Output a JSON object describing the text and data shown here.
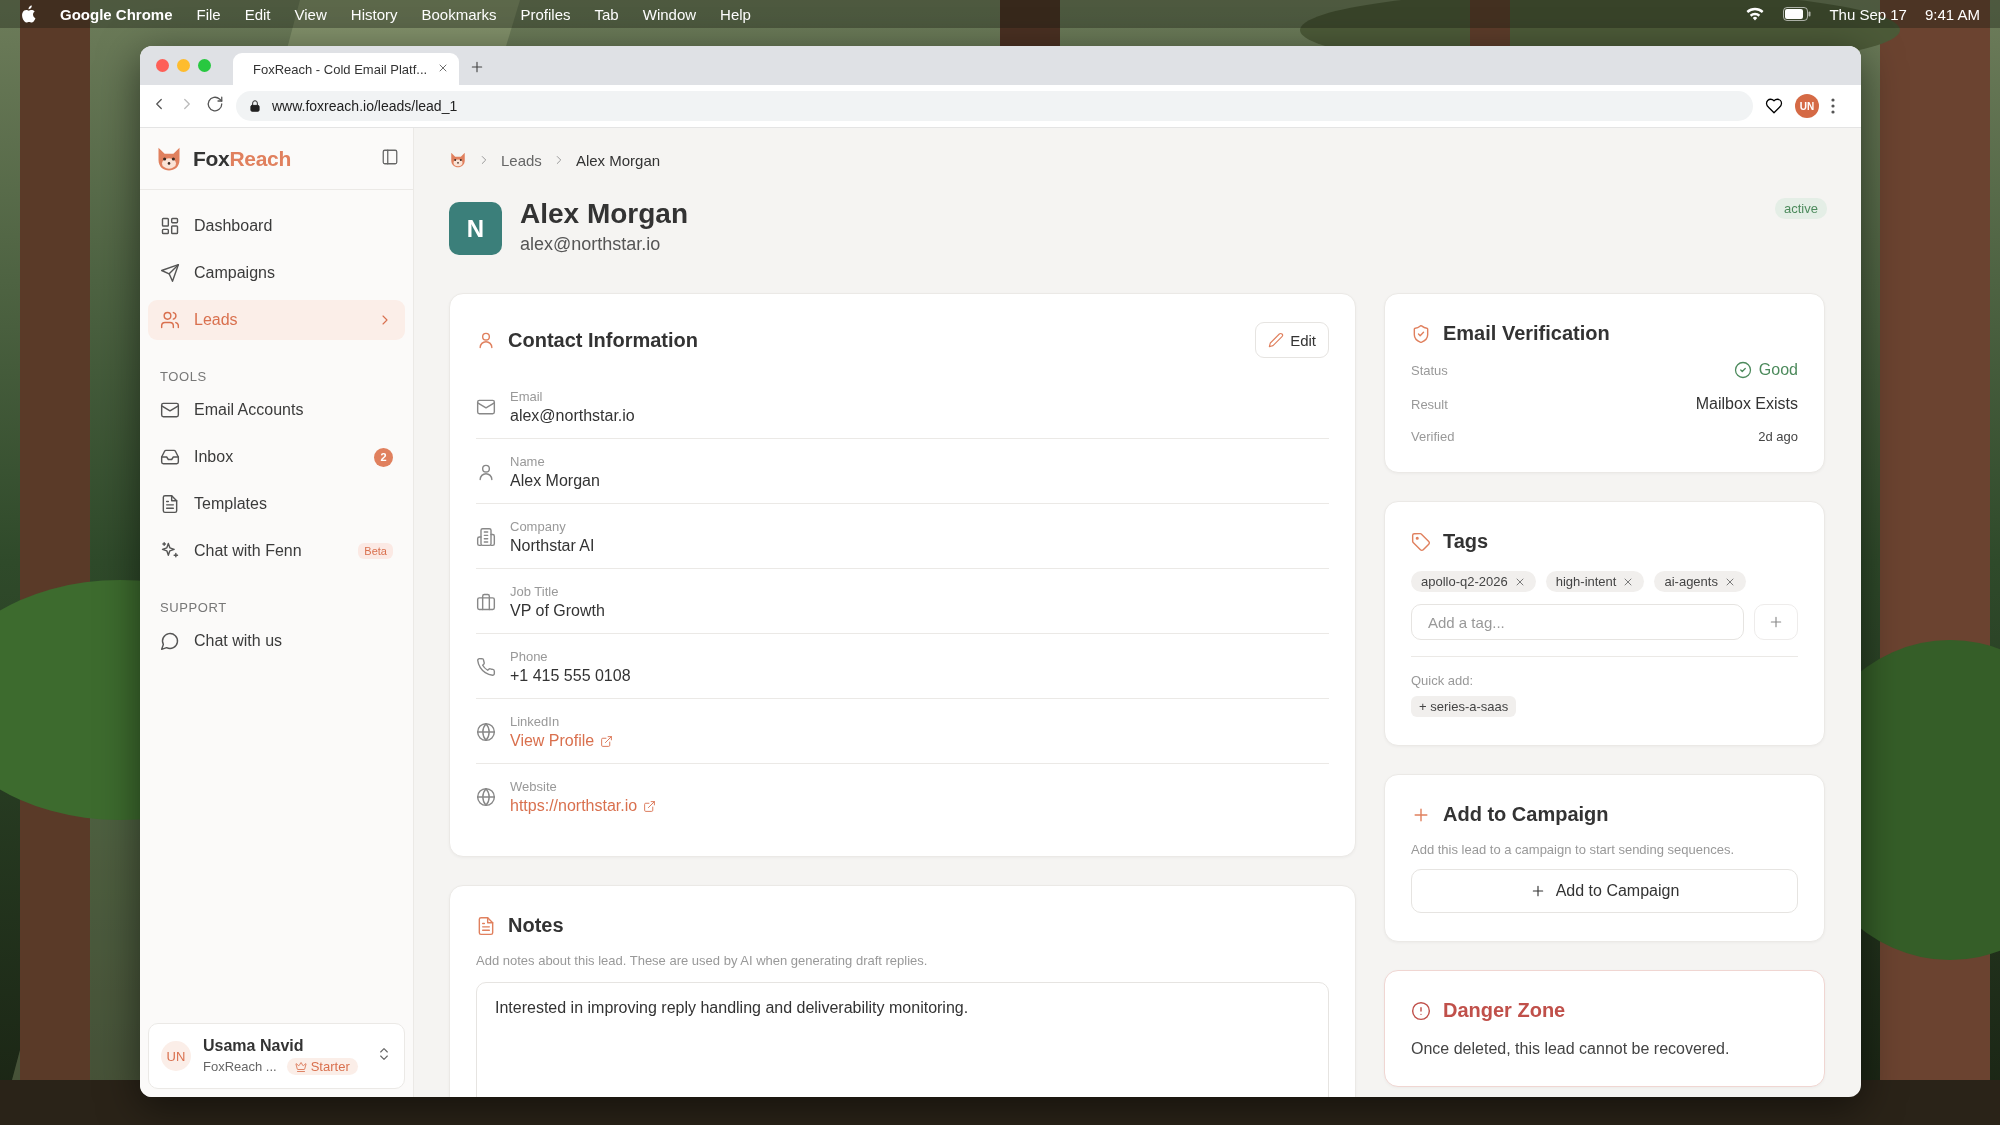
{
  "menubar": {
    "app": "Google Chrome",
    "menus": [
      "File",
      "Edit",
      "View",
      "History",
      "Bookmarks",
      "Profiles",
      "Tab",
      "Window",
      "Help"
    ],
    "date": "Thu Sep 17",
    "time": "9:41 AM"
  },
  "browser": {
    "tab_title": "FoxReach - Cold Email Platf...",
    "url": "www.foxreach.io/leads/lead_1",
    "profile": "UN"
  },
  "sidebar": {
    "brand_first": "Fox",
    "brand_second": "Reach",
    "sections": [
      {
        "items": [
          {
            "label": "Dashboard",
            "selected": false
          },
          {
            "label": "Campaigns",
            "selected": false
          },
          {
            "label": "Leads",
            "selected": true
          }
        ]
      },
      {
        "heading": "TOOLS",
        "items": [
          {
            "label": "Email Accounts",
            "selected": false
          },
          {
            "label": "Inbox",
            "selected": false,
            "badge": "2"
          },
          {
            "label": "Templates",
            "selected": false
          },
          {
            "label": "Chat with Fenn",
            "selected": false,
            "tag": "Beta"
          }
        ]
      },
      {
        "heading": "SUPPORT",
        "items": [
          {
            "label": "Chat with us",
            "selected": false
          }
        ]
      }
    ],
    "user": {
      "initials": "UN",
      "name": "Usama Navid",
      "org": "FoxReach ...",
      "plan": "Starter"
    }
  },
  "breadcrumb": [
    "Leads",
    "Alex Morgan"
  ],
  "lead": {
    "initial": "N",
    "name": "Alex Morgan",
    "email": "alex@northstar.io",
    "status": "active"
  },
  "contact": {
    "title": "Contact Information",
    "edit": "Edit",
    "fields": [
      {
        "label": "Email",
        "value": "alex@northstar.io",
        "kind": "text"
      },
      {
        "label": "Name",
        "value": "Alex Morgan",
        "kind": "text"
      },
      {
        "label": "Company",
        "value": "Northstar AI",
        "kind": "text"
      },
      {
        "label": "Job Title",
        "value": "VP of Growth",
        "kind": "text"
      },
      {
        "label": "Phone",
        "value": "+1 415 555 0108",
        "kind": "text"
      },
      {
        "label": "LinkedIn",
        "value": "View Profile",
        "kind": "link"
      },
      {
        "label": "Website",
        "value": "https://northstar.io",
        "kind": "link"
      }
    ]
  },
  "notes": {
    "title": "Notes",
    "hint": "Add notes about this lead. These are used by AI when generating draft replies.",
    "value": "Interested in improving reply handling and deliverability monitoring."
  },
  "verification": {
    "title": "Email Verification",
    "rows": [
      {
        "label": "Status",
        "value": "Good",
        "kind": "status"
      },
      {
        "label": "Result",
        "value": "Mailbox Exists",
        "kind": "strong"
      },
      {
        "label": "Verified",
        "value": "2d ago",
        "kind": "small"
      }
    ]
  },
  "tags": {
    "title": "Tags",
    "items": [
      "apollo-q2-2026",
      "high-intent",
      "ai-agents"
    ],
    "placeholder": "Add a tag...",
    "quick_label": "Quick add:",
    "quick": [
      "+ series-a-saas"
    ]
  },
  "campaign": {
    "title": "Add to Campaign",
    "hint": "Add this lead to a campaign to start sending sequences.",
    "button": "Add to Campaign"
  },
  "danger": {
    "title": "Danger Zone",
    "text": "Once deleted, this lead cannot be recovered."
  }
}
